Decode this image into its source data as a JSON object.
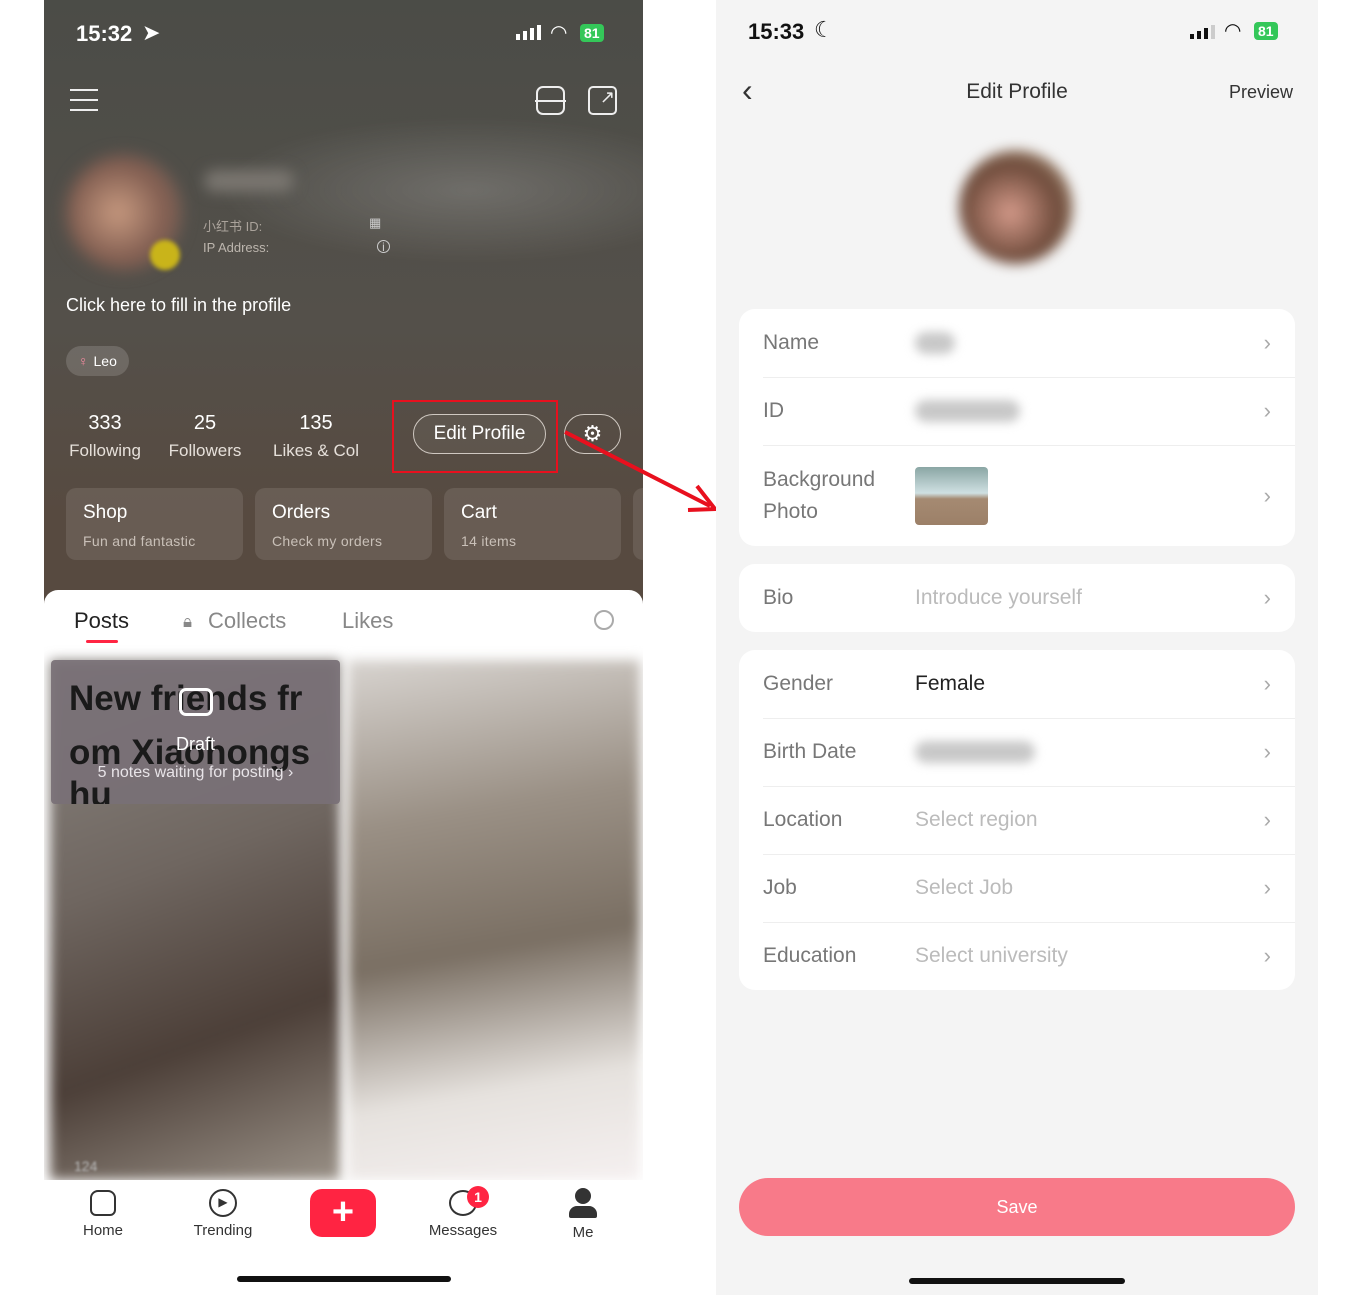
{
  "left": {
    "status": {
      "time": "15:32",
      "battery": "81"
    },
    "profile": {
      "id_label": "小红书 ID:",
      "ip_label": "IP Address:",
      "fill_prompt": "Click here to fill in the profile",
      "zodiac_tag": "Leo"
    },
    "stats": [
      {
        "value": "333",
        "label": "Following"
      },
      {
        "value": "25",
        "label": "Followers"
      },
      {
        "value": "135",
        "label": "Likes & Col"
      }
    ],
    "edit_profile": "Edit Profile",
    "cards": [
      {
        "title": "Shop",
        "subtitle": "Fun and fantastic"
      },
      {
        "title": "Orders",
        "subtitle": "Check my orders"
      },
      {
        "title": "Cart",
        "subtitle": "14 items"
      }
    ],
    "tabs": [
      {
        "label": "Posts",
        "active": true
      },
      {
        "label": "Collects"
      },
      {
        "label": "Likes"
      }
    ],
    "draft": {
      "bg_text_1": "New friends fr",
      "bg_text_2": "om Xiaohongs",
      "bg_text_3": "hu",
      "label": "Draft",
      "subtitle": "5 notes waiting for posting ›"
    },
    "post_views": "124",
    "nav": [
      {
        "label": "Home",
        "icon": "home-icon"
      },
      {
        "label": "Trending",
        "icon": "play-icon"
      },
      {
        "label": "",
        "icon": "plus-icon"
      },
      {
        "label": "Messages",
        "icon": "chat-icon",
        "badge": "1"
      },
      {
        "label": "Me",
        "icon": "user-icon"
      }
    ],
    "accent": "#ff2442"
  },
  "right": {
    "status": {
      "time": "15:33",
      "battery": "81"
    },
    "header": {
      "title": "Edit Profile",
      "preview": "Preview"
    },
    "groups": [
      [
        {
          "label": "Name",
          "value": ""
        },
        {
          "label": "ID",
          "value": ""
        },
        {
          "label": "Background Photo",
          "value": ""
        }
      ],
      [
        {
          "label": "Bio",
          "value": "Introduce yourself"
        }
      ],
      [
        {
          "label": "Gender",
          "value": "Female"
        },
        {
          "label": "Birth Date",
          "value": ""
        },
        {
          "label": "Location",
          "value": "Select region"
        },
        {
          "label": "Job",
          "value": "Select Job"
        },
        {
          "label": "Education",
          "value": "Select university"
        }
      ]
    ],
    "save": "Save",
    "save_color": "#f87a89"
  }
}
